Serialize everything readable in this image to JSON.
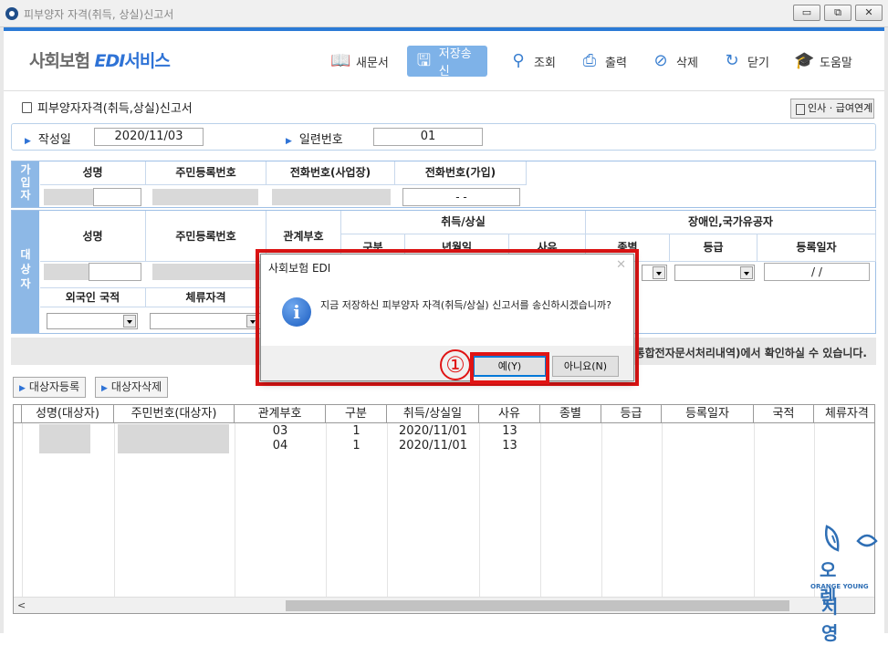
{
  "window": {
    "title": "피부양자 자격(취득, 상실)신고서",
    "min_glyph": "▭",
    "restore_glyph": "⧉",
    "close_glyph": "✕"
  },
  "logo": {
    "part1": "사회보험 ",
    "part2": "EDI",
    "part3": "서비스"
  },
  "toolbar": [
    {
      "label": "새문서",
      "icon": "book-icon",
      "glyph": "📖"
    },
    {
      "label": "저장송신",
      "icon": "save-icon",
      "glyph": "🖫"
    },
    {
      "label": "조회",
      "icon": "search-pin-icon",
      "glyph": "⚲"
    },
    {
      "label": "출력",
      "icon": "printer-icon",
      "glyph": "⎙"
    },
    {
      "label": "삭제",
      "icon": "delete-icon",
      "glyph": "⊘"
    },
    {
      "label": "닫기",
      "icon": "close-circle-icon",
      "glyph": "↻"
    },
    {
      "label": "도움말",
      "icon": "graduation-cap-icon",
      "glyph": "🎓"
    }
  ],
  "form": {
    "title": "피부양자자격(취득,상실)신고서",
    "hr_button": "인사 · 급여연계",
    "written_date_label": "작성일",
    "written_date_value": "2020/11/03",
    "serial_label": "일련번호",
    "serial_value": "01"
  },
  "subscriber": {
    "side": "가입자",
    "headers": [
      "성명",
      "주민등록번호",
      "전화번호(사업장)",
      "전화번호(가입)"
    ],
    "phone_value": "-         -"
  },
  "target": {
    "side": "대상자",
    "headers": {
      "name": "성명",
      "rrn": "주민등록번호",
      "relation": "관계부호",
      "acq_loss": "취득/상실",
      "gubun": "구분",
      "date": "년월일",
      "reason": "사유",
      "disabled": "장애인,국가유공자",
      "kind": "종별",
      "grade": "등급",
      "reg_date": "등록일자",
      "nationality": "외국인 국적",
      "stay": "체류자격"
    },
    "reg_date_value": "/ /"
  },
  "notice": "통합전자문서처리내역)에서 확인하실 수 있습니다.",
  "buttons": {
    "register": "대상자등록",
    "delete": "대상자삭제"
  },
  "table": {
    "headers": [
      "성명(대상자)",
      "주민번호(대상자)",
      "관계부호",
      "구분",
      "취득/상실일",
      "사유",
      "종별",
      "등급",
      "등록일자",
      "국적",
      "체류자격"
    ],
    "rows": [
      {
        "relation": "03",
        "gubun": "1",
        "date": "2020/11/01",
        "reason": "13"
      },
      {
        "relation": "04",
        "gubun": "1",
        "date": "2020/11/01",
        "reason": "13"
      }
    ]
  },
  "dialog": {
    "title": "사회보험 EDI",
    "message": "지금 저장하신 피부양자 자격(취득/상실) 신고서를 송신하시겠습니까?",
    "yes": "예(Y)",
    "no": "아니요(N)",
    "step_marker": "①"
  },
  "watermark": {
    "line1": "오 렌",
    "mid": "ORANGE    YOUNG",
    "line2": "지 영"
  },
  "colors": {
    "accent": "#2f73d6",
    "highlight": "#e01414",
    "side_header": "#8db8e6"
  }
}
